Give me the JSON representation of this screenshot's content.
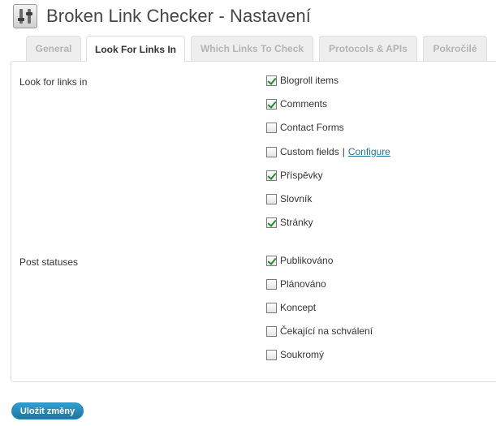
{
  "header": {
    "title": "Broken Link Checker - Nastavení",
    "icon": "settings-sliders-icon"
  },
  "tabs": [
    {
      "label": "General",
      "active": false
    },
    {
      "label": "Look For Links In",
      "active": true
    },
    {
      "label": "Which Links To Check",
      "active": false
    },
    {
      "label": "Protocols & APIs",
      "active": false
    },
    {
      "label": "Pokročilé",
      "active": false
    }
  ],
  "look_for_links": {
    "label": "Look for links in",
    "options": [
      {
        "label": "Blogroll items",
        "checked": true
      },
      {
        "label": "Comments",
        "checked": true
      },
      {
        "label": "Contact Forms",
        "checked": false
      },
      {
        "label": "Custom fields",
        "checked": false,
        "separator": "|",
        "link": "Configure"
      },
      {
        "label": "Příspěvky",
        "checked": true
      },
      {
        "label": "Slovník",
        "checked": false
      },
      {
        "label": "Stránky",
        "checked": true
      }
    ]
  },
  "post_statuses": {
    "label": "Post statuses",
    "options": [
      {
        "label": "Publikováno",
        "checked": true
      },
      {
        "label": "Plánováno",
        "checked": false
      },
      {
        "label": "Koncept",
        "checked": false
      },
      {
        "label": "Čekající na schválení",
        "checked": false
      },
      {
        "label": "Soukromý",
        "checked": false
      }
    ]
  },
  "save_button": {
    "label": "Uložit změny"
  },
  "colors": {
    "link": "#21759b",
    "primary_button": "#21759b",
    "checkmark": "#2a8a2a",
    "border": "#dfdfdf"
  }
}
